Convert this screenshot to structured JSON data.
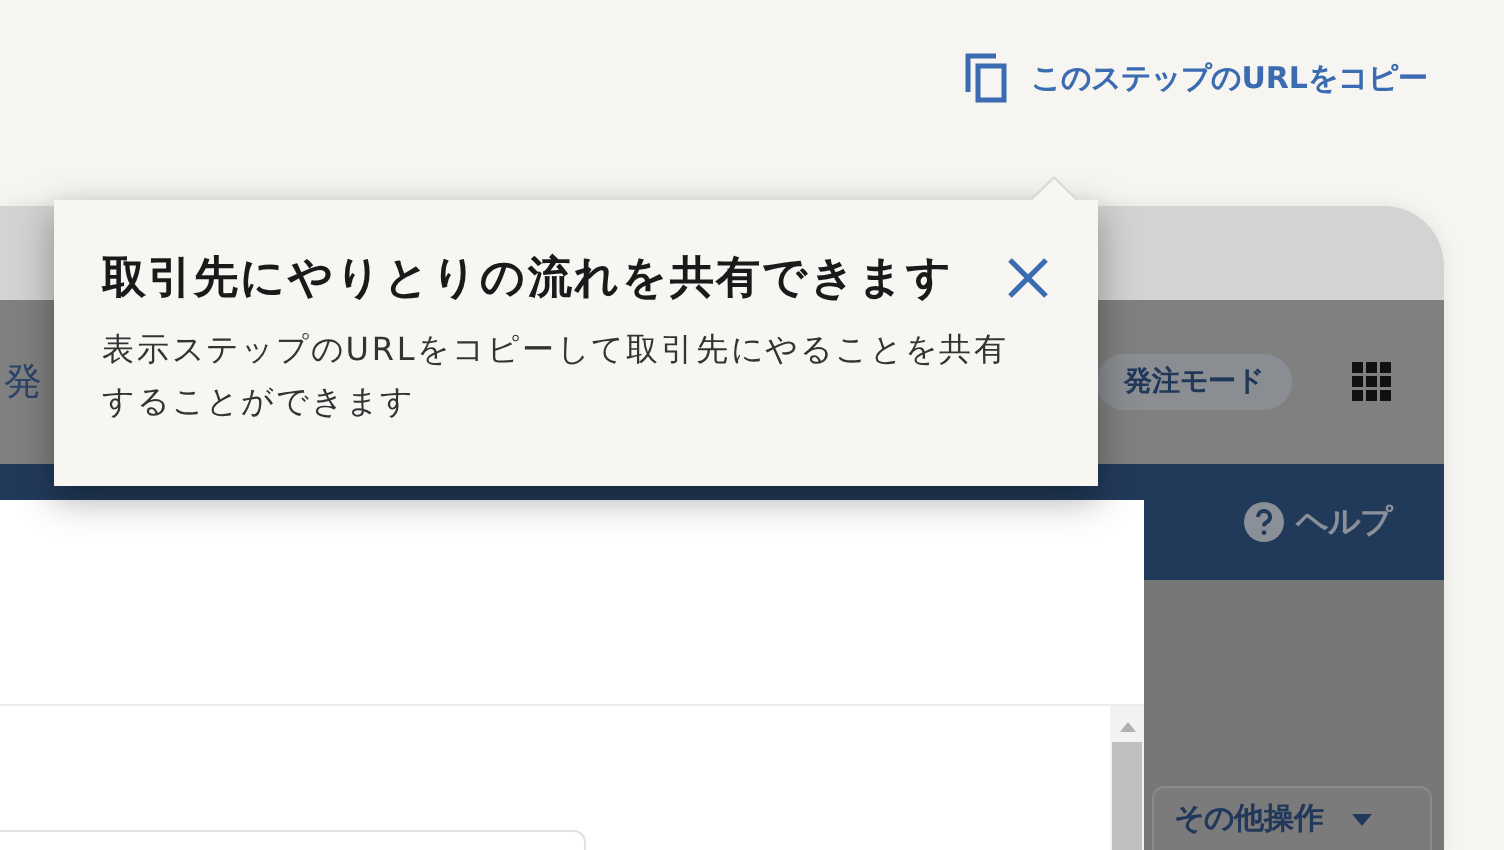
{
  "copy_link": {
    "label": "このステップのURLをコピー"
  },
  "tooltip": {
    "title": "取引先にやりとりの流れを共有できます",
    "body": "表示ステップのURLをコピーして取引先にやることを共有することができます"
  },
  "app": {
    "header_title": "発",
    "mode_badge": "発注モード",
    "help": "ヘルプ",
    "more_actions": "その他操作"
  }
}
